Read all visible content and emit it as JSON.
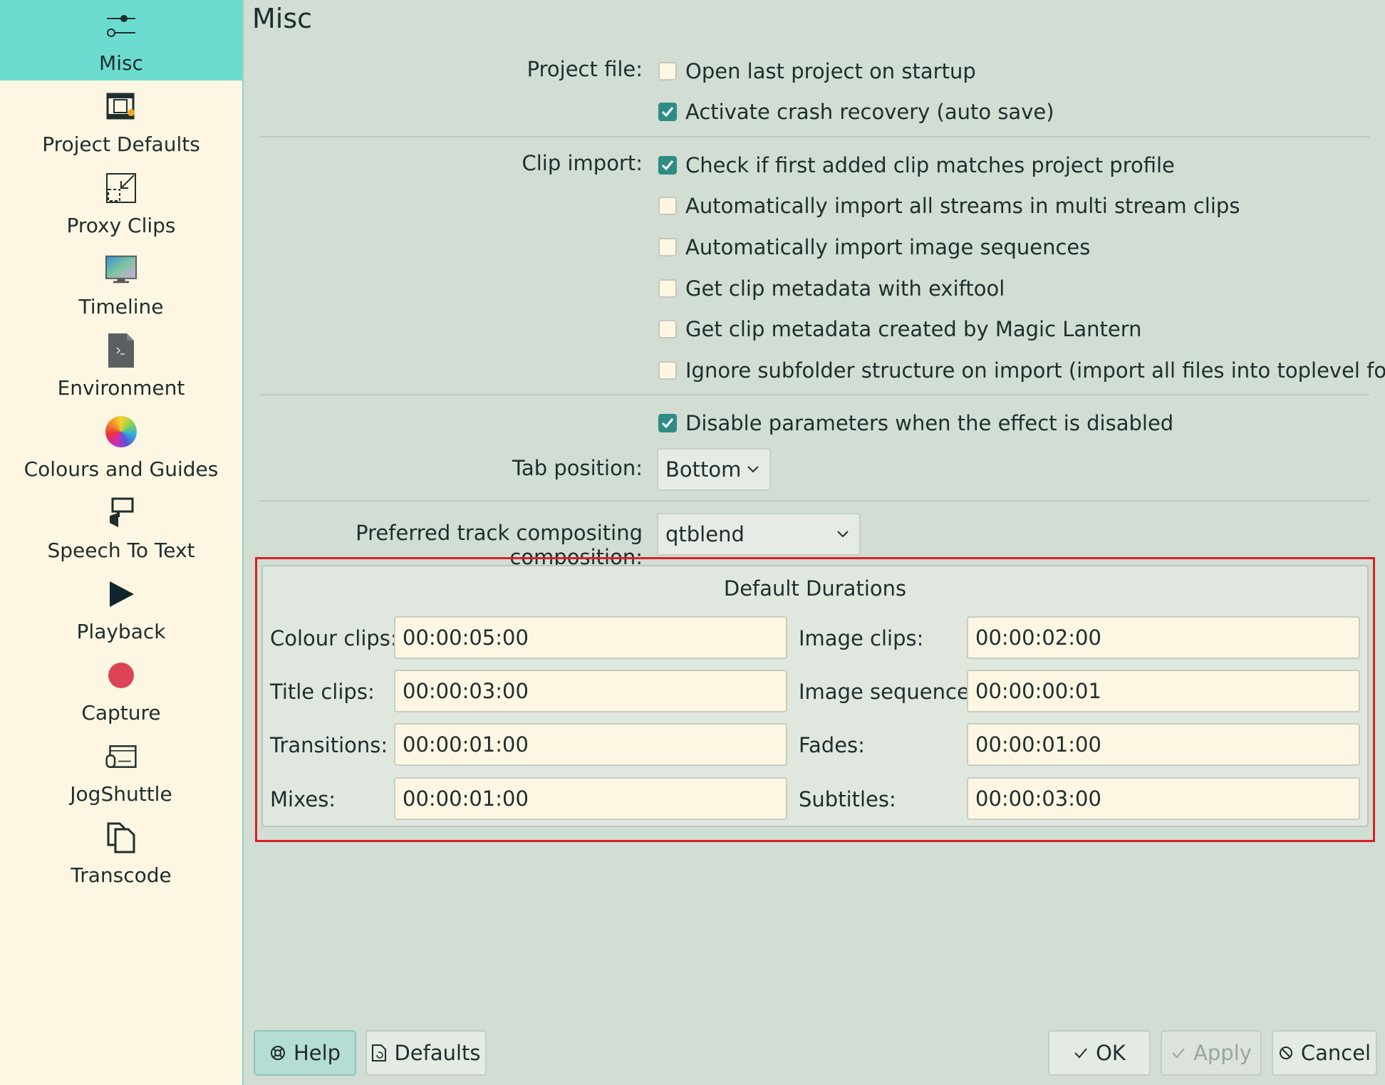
{
  "sidebar": {
    "items": [
      {
        "label": "Misc",
        "icon": "sliders-icon"
      },
      {
        "label": "Project Defaults",
        "icon": "film-icon"
      },
      {
        "label": "Proxy Clips",
        "icon": "proxy-icon"
      },
      {
        "label": "Timeline",
        "icon": "monitor-icon"
      },
      {
        "label": "Environment",
        "icon": "terminal-file-icon"
      },
      {
        "label": "Colours and Guides",
        "icon": "color-wheel-icon"
      },
      {
        "label": "Speech To Text",
        "icon": "speech-icon"
      },
      {
        "label": "Playback",
        "icon": "play-icon"
      },
      {
        "label": "Capture",
        "icon": "record-icon"
      },
      {
        "label": "JogShuttle",
        "icon": "jogshuttle-icon"
      },
      {
        "label": "Transcode",
        "icon": "transcode-icon"
      }
    ]
  },
  "main": {
    "title": "Misc",
    "project_file": {
      "label": "Project file:",
      "options": [
        {
          "text": "Open last project on startup",
          "checked": false
        },
        {
          "text": "Activate crash recovery (auto save)",
          "checked": true
        }
      ]
    },
    "clip_import": {
      "label": "Clip import:",
      "options": [
        {
          "text": "Check if first added clip matches project profile",
          "checked": true
        },
        {
          "text": "Automatically import all streams in multi stream clips",
          "checked": false
        },
        {
          "text": "Automatically import image sequences",
          "checked": false
        },
        {
          "text": "Get clip metadata with exiftool",
          "checked": false
        },
        {
          "text": "Get clip metadata created by Magic Lantern",
          "checked": false
        },
        {
          "text": "Ignore subfolder structure on import (import all files into toplevel folder)",
          "checked": false
        }
      ]
    },
    "disable_params": {
      "text": "Disable parameters when the effect is disabled",
      "checked": true
    },
    "tab_position": {
      "label": "Tab position:",
      "value": "Bottom"
    },
    "compositing": {
      "label": "Preferred track compositing composition:",
      "value": "qtblend"
    },
    "durations": {
      "title": "Default Durations",
      "colour_clips": {
        "label": "Colour clips:",
        "value": "00:00:05:00"
      },
      "image_clips": {
        "label": "Image clips:",
        "value": "00:00:02:00"
      },
      "title_clips": {
        "label": "Title clips:",
        "value": "00:00:03:00"
      },
      "image_sequence": {
        "label": "Image sequence:",
        "value": "00:00:00:01"
      },
      "transitions": {
        "label": "Transitions:",
        "value": "00:00:01:00"
      },
      "fades": {
        "label": "Fades:",
        "value": "00:00:01:00"
      },
      "mixes": {
        "label": "Mixes:",
        "value": "00:00:01:00"
      },
      "subtitles": {
        "label": "Subtitles:",
        "value": "00:00:03:00"
      }
    }
  },
  "buttons": {
    "help": "Help",
    "defaults": "Defaults",
    "ok": "OK",
    "apply": "Apply",
    "cancel": "Cancel"
  },
  "colors": {
    "accent": "#6cdcd0",
    "checked": "#2f8c85",
    "highlight": "#d9202a"
  }
}
